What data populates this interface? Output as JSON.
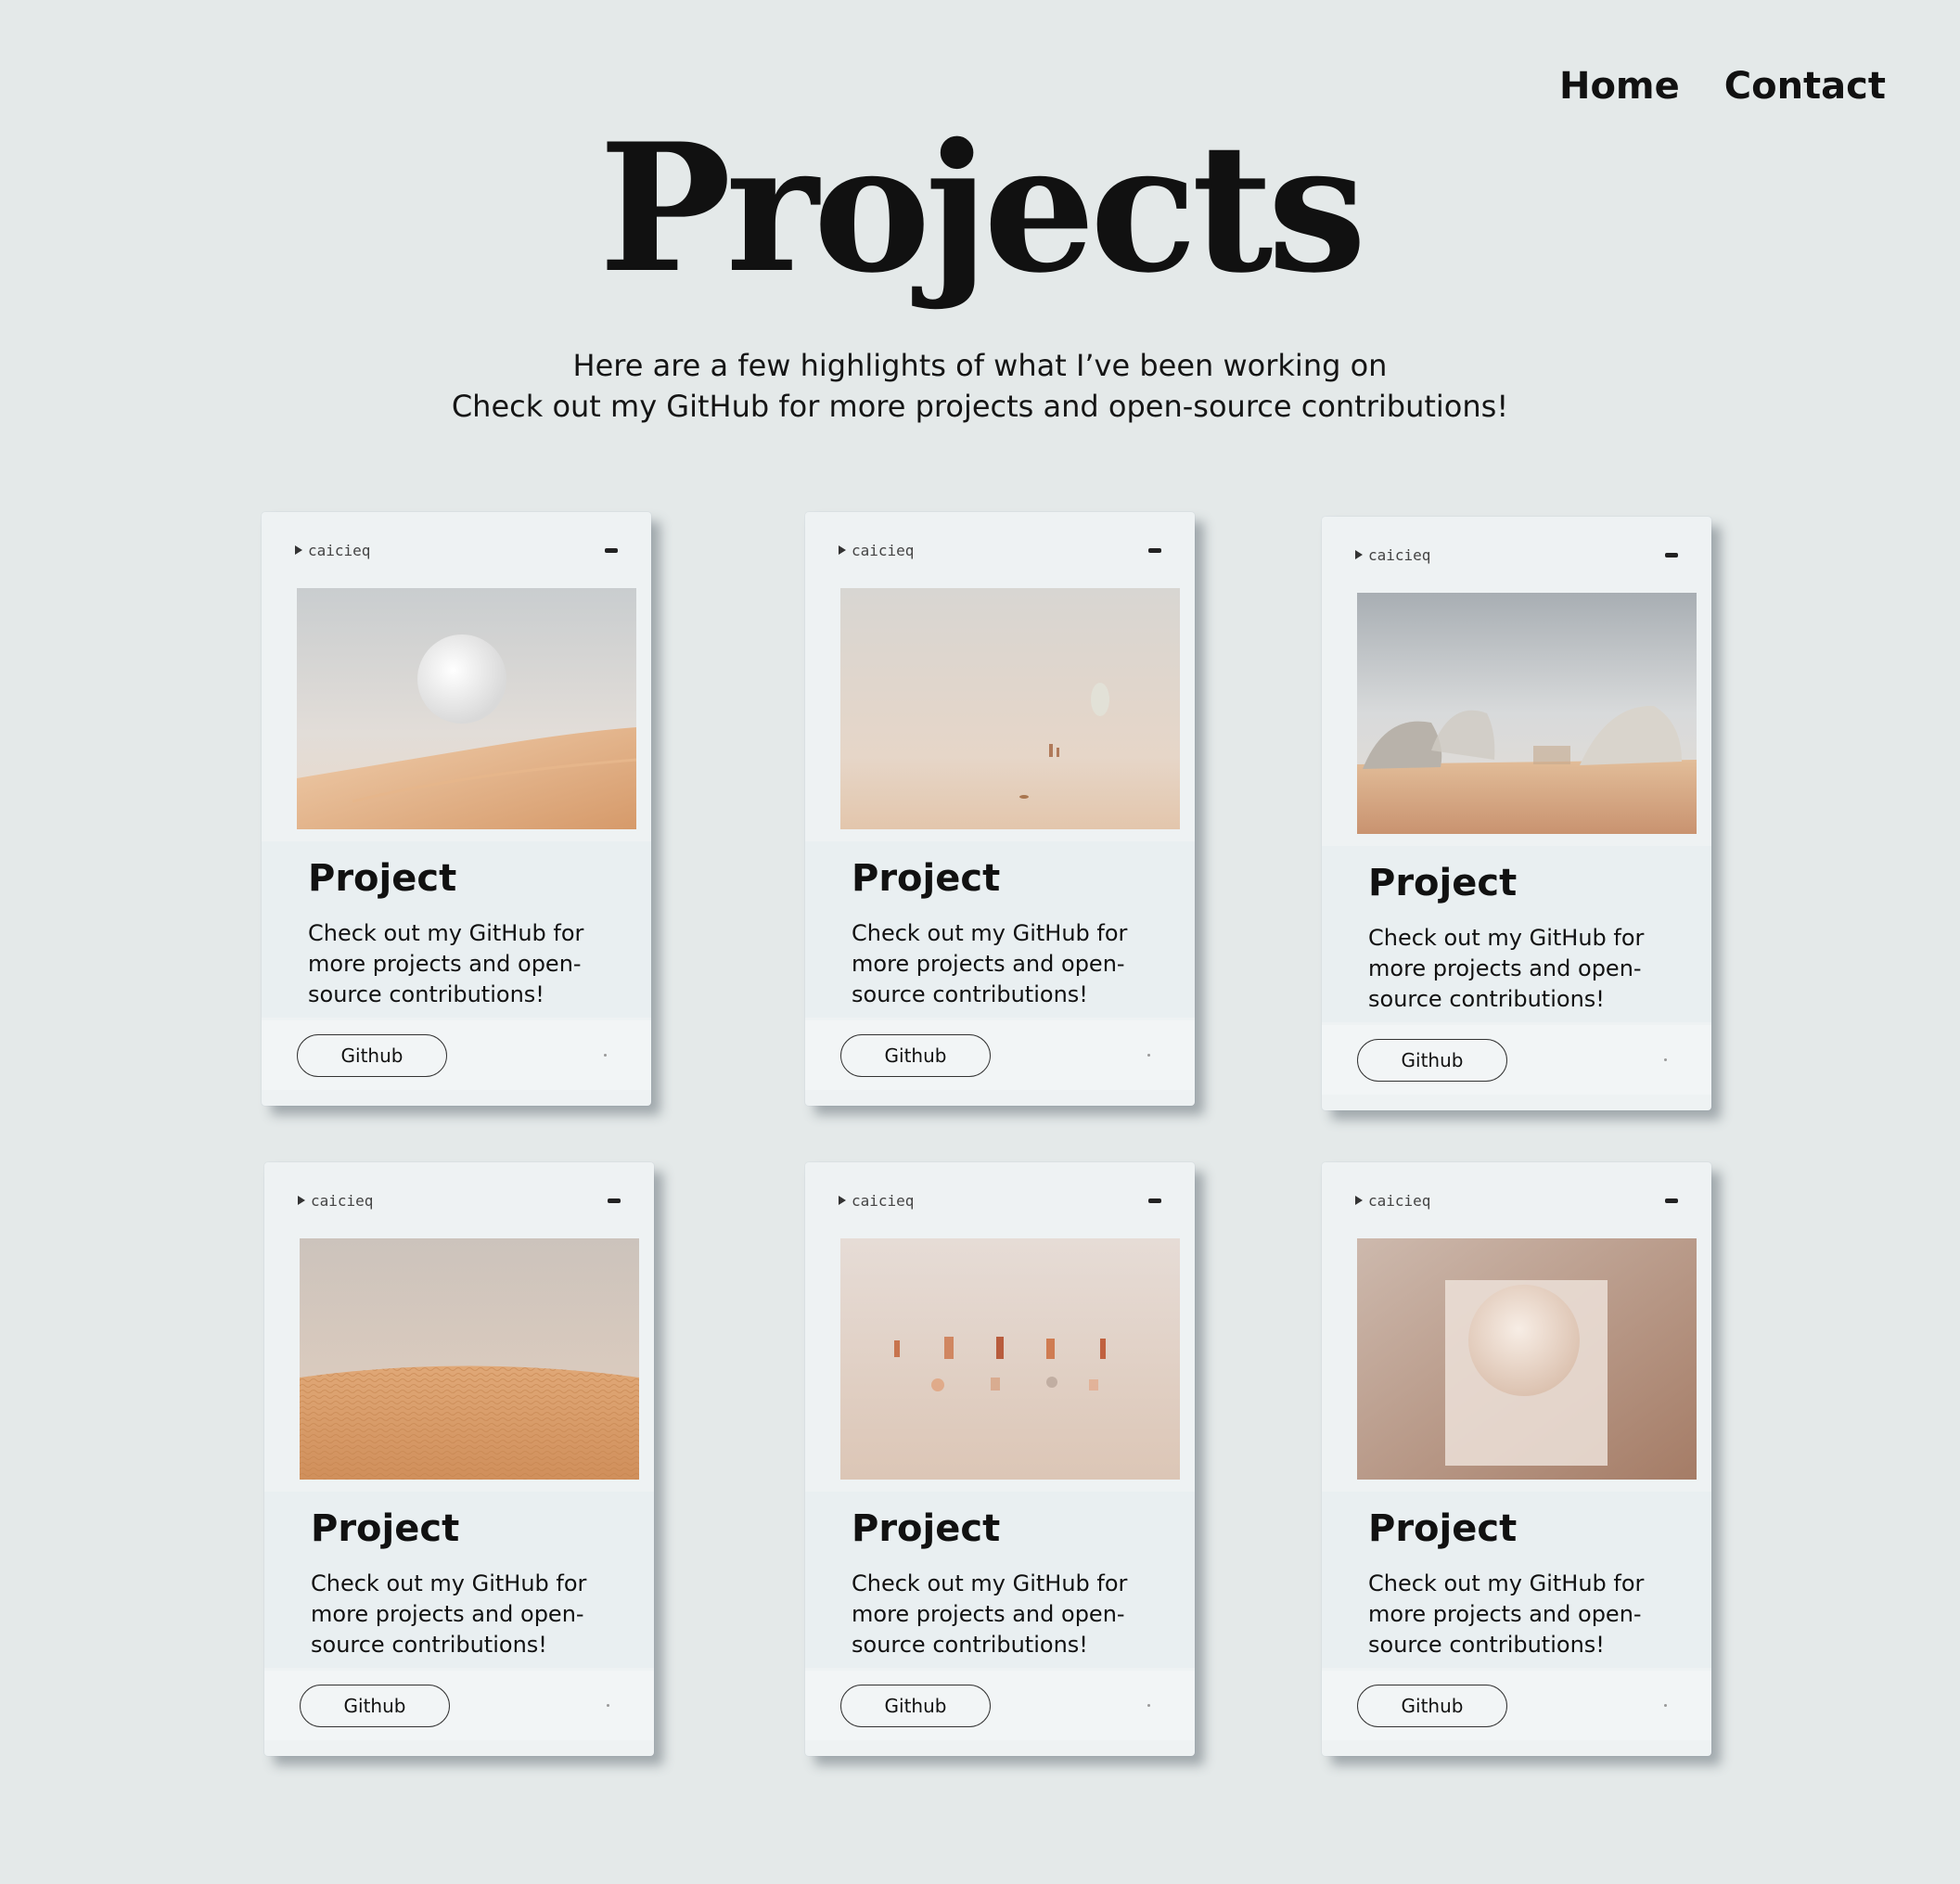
{
  "nav": {
    "home": "Home",
    "contact": "Contact"
  },
  "page": {
    "title": "Projects",
    "intro_line1": "Here are a few highlights of what I’ve been working on",
    "intro_line2": "Check out my GitHub for more projects and open-source contributions!"
  },
  "projects": [
    {
      "brand": "caicieq",
      "title": "Project",
      "description": "Check out my GitHub for more projects and open-source contributions!",
      "button": "Github",
      "image": "desert-moon"
    },
    {
      "brand": "caicieq",
      "title": "Project",
      "description": "Check out my GitHub for more projects and open-source contributions!",
      "button": "Github",
      "image": "hazy-desert"
    },
    {
      "brand": "caicieq",
      "title": "Project",
      "description": "Check out my GitHub for more projects and open-source contributions!",
      "button": "Github",
      "image": "desert-domes"
    },
    {
      "brand": "caicieq",
      "title": "Project",
      "description": "Check out my GitHub for more projects and open-source contributions!",
      "button": "Github",
      "image": "sand-dunes"
    },
    {
      "brand": "caicieq",
      "title": "Project",
      "description": "Check out my GitHub for more projects and open-source contributions!",
      "button": "Github",
      "image": "wall-objects"
    },
    {
      "brand": "caicieq",
      "title": "Project",
      "description": "Check out my GitHub for more projects and open-source contributions!",
      "button": "Github",
      "image": "paper-moon"
    }
  ],
  "colors": {
    "background": "#e4e9e9",
    "card": "#eef2f3",
    "sand": "#d9a77c"
  }
}
